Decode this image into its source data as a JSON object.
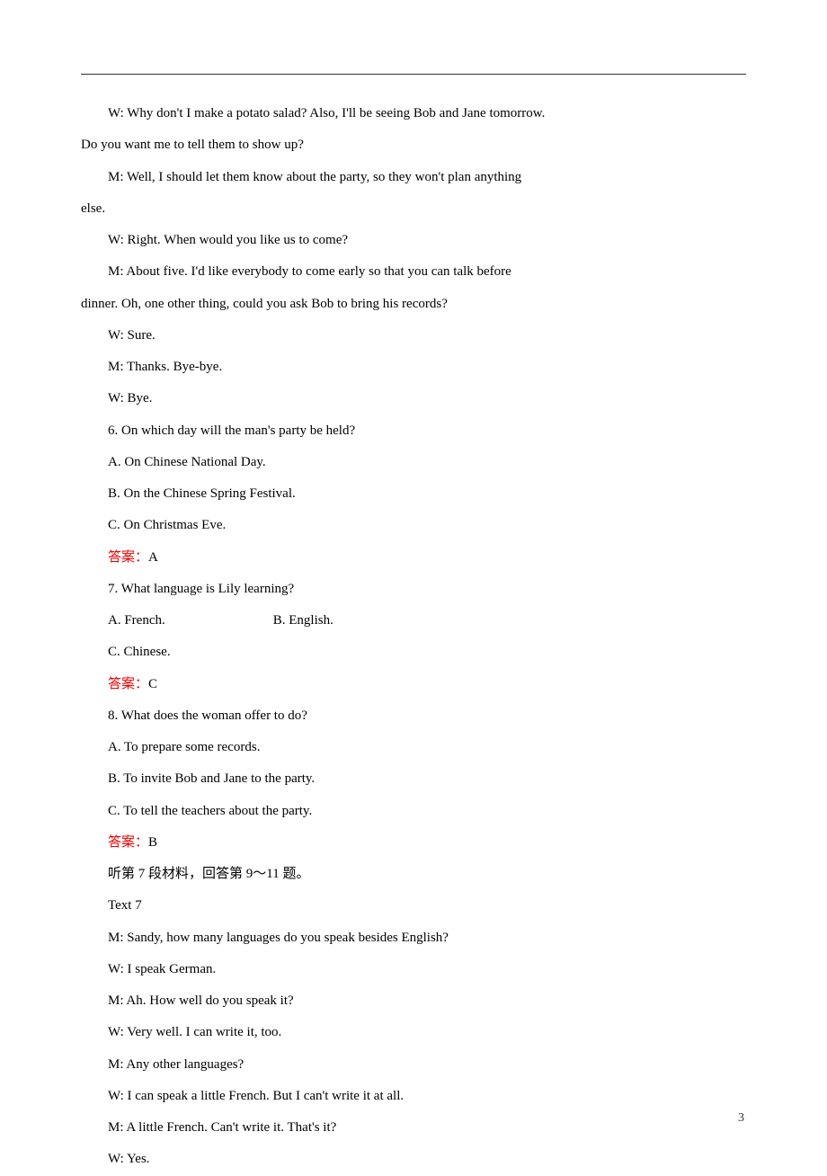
{
  "lines": {
    "l1": "W: Why don't I make a potato salad? Also, I'll be seeing Bob and Jane tomorrow.",
    "l2": "Do you want me to tell  them to show up?",
    "l3": "M: Well, I should let them know about the party, so  they won't plan anything",
    "l4": "else.",
    "l5": "W: Right. When would you like us to come?",
    "l6": "M: About five. I'd like everybody to come early so that    you can talk before",
    "l7": "dinner. Oh, one other thing,    could you ask Bob to bring his records?",
    "l8": "W: Sure.",
    "l9": "M: Thanks. Bye-bye.",
    "l10": "W: Bye.",
    "l11": "6. On which day will the man's party be held?",
    "l12": "A. On Chinese National Day.",
    "l13": "B. On the Chinese Spring Festival.",
    "l14": " C. On Christmas Eve.",
    "ansA_label": "答案：",
    "ansA_val": "A",
    "l16": "7. What language is Lily learning?",
    "l17a": "A. French.",
    "l17b": "B. English.",
    "l18": "C. Chinese.",
    "ansC_label": "答案：",
    "ansC_val": "C",
    "l20": "8. What does the woman offer to do?",
    "l21": "A. To prepare some records.",
    "l22": "B. To invite Bob and Jane to the party.",
    "l23": "C. To tell the teachers about the party.",
    "ansB_label": "答案：",
    "ansB_val": "B",
    "l25": "听第 7 段材料，回答第 9～11 题。",
    "l26": "Text 7",
    "l27": "M: Sandy, how many languages do you speak besides    English?",
    "l28": "W: I speak German.",
    "l29": "M: Ah. How well do you speak it?",
    "l30": "W: Very well. I can write it, too.",
    "l31": "M: Any other languages?",
    "l32": "W: I can speak a little French. But I can't write it at all.",
    "l33": "M: A little French. Can't write it. That's it?",
    "l34": "W: Yes."
  },
  "pageNumber": "3"
}
